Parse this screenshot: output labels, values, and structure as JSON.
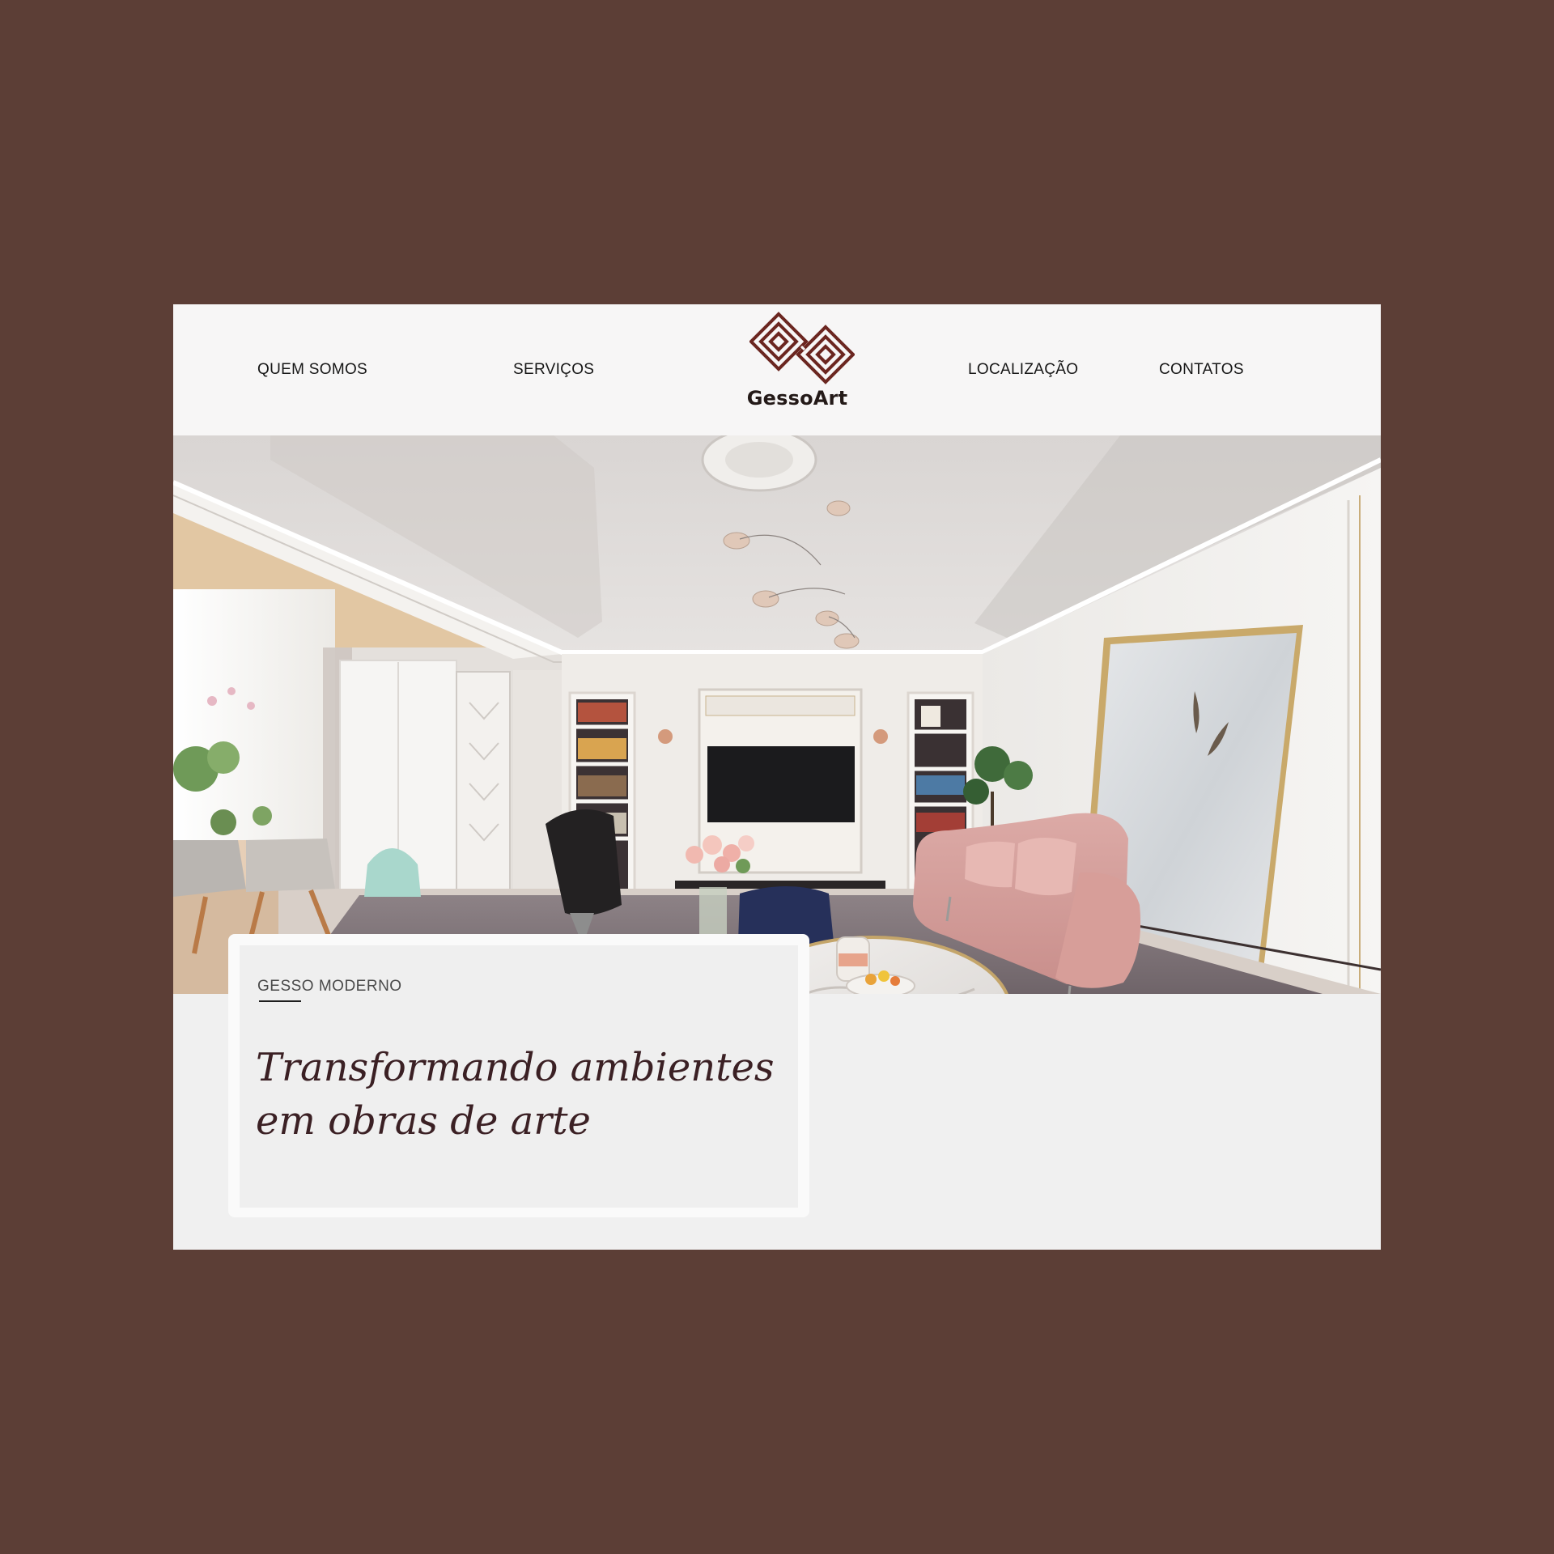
{
  "nav": {
    "left": [
      "QUEM SOMOS",
      "SERVIÇOS"
    ],
    "right": [
      "LOCALIZAÇÃO",
      "CONTATOS"
    ]
  },
  "logo": {
    "name": "GessoArt",
    "mark_icon": "interlocked-diamond-logo-icon",
    "color": "#6b2620"
  },
  "hero": {
    "image": "living-room-interior-photo",
    "kicker": "GESSO MODERNO",
    "title": "Transformando ambientes em obras de arte"
  },
  "colors": {
    "page_background": "#5c3e36",
    "header_background": "#f7f6f6",
    "card_background": "#efefef",
    "title_color": "#3b2024"
  }
}
